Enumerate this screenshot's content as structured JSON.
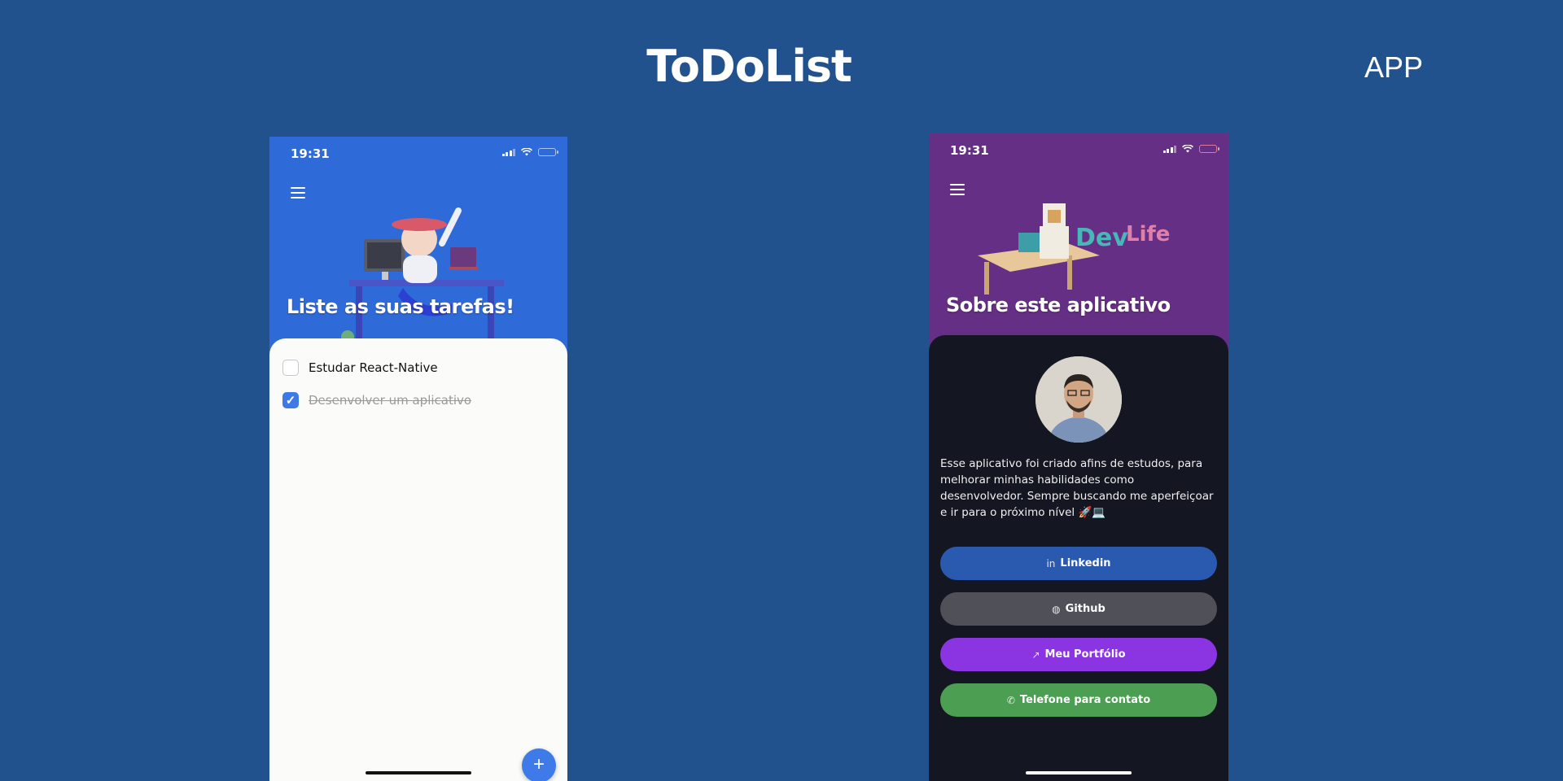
{
  "header": {
    "title": "ToDoList",
    "side_label": "APP"
  },
  "phone_todo": {
    "status_time": "19:31",
    "hero_title": "Liste as suas tarefas!",
    "tasks": [
      {
        "label": "Estudar React-Native",
        "done": false
      },
      {
        "label": "Desenvolver um aplicativo",
        "done": true
      }
    ],
    "fab_label": "+",
    "colors": {
      "header_bg": "#2f6ad9",
      "sheet_bg": "#fbfbfa",
      "accent": "#3f79e6"
    }
  },
  "phone_about": {
    "status_time": "19:31",
    "hero_title": "Sobre este aplicativo",
    "about_text": "Esse aplicativo foi criado afins de estudos, para melhorar minhas habilidades como desenvolvedor. Sempre buscando me aperfeiçoar e ir para o próximo nível 🚀💻",
    "buttons": [
      {
        "label": "Linkedin",
        "icon": "linkedin-icon",
        "color": "#2a5ab0"
      },
      {
        "label": "Github",
        "icon": "github-icon",
        "color": "#505158"
      },
      {
        "label": "Meu Portfólio",
        "icon": "external-link-icon",
        "color": "#8a34e2"
      },
      {
        "label": "Telefone para contato",
        "icon": "phone-icon",
        "color": "#4c9f52"
      }
    ],
    "colors": {
      "header_bg": "#662f86",
      "sheet_bg": "#141721"
    }
  }
}
